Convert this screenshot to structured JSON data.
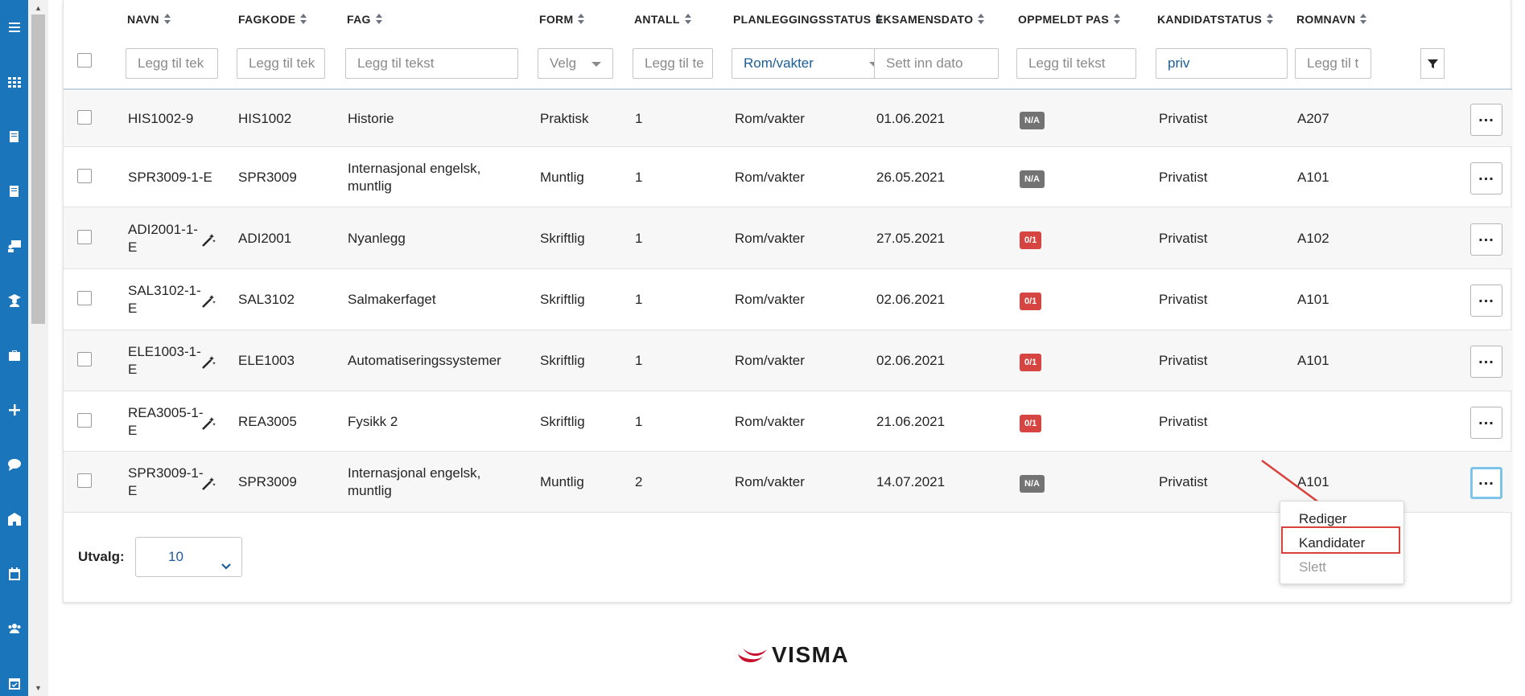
{
  "sidebar": {
    "icons": [
      "menu-icon",
      "apps-grid-icon",
      "book-icon",
      "book-open-icon",
      "presentation-icon",
      "graduate-icon",
      "briefcase-icon",
      "plus-icon",
      "chat-icon",
      "school-icon",
      "calendar-icon",
      "users-icon",
      "calendar-check-icon"
    ]
  },
  "table": {
    "columns": [
      {
        "label": "NAVN",
        "filter": "Legg til tek",
        "filled": false
      },
      {
        "label": "FAGKODE",
        "filter": "Legg til tek",
        "filled": false
      },
      {
        "label": "FAG",
        "filter": "Legg til tekst",
        "filled": false
      },
      {
        "label": "FORM",
        "filter": "Velg",
        "filled": false,
        "select": true
      },
      {
        "label": "ANTALL",
        "filter": "Legg til te",
        "filled": false
      },
      {
        "label": "PLANLEGGINGSSTATUS",
        "filter": "Rom/vakter",
        "filled": true,
        "select": true
      },
      {
        "label": "EKSAMENSDATO",
        "filter": "Sett inn dato",
        "filled": false
      },
      {
        "label": "OPPMELDT PAS",
        "filter": "Legg til tekst",
        "filled": false
      },
      {
        "label": "KANDIDATSTATUS",
        "filter": "priv",
        "filled": true
      },
      {
        "label": "ROMNAVN",
        "filter": "Legg til t",
        "filled": false
      }
    ],
    "rows": [
      {
        "navn": "HIS1002-9",
        "navn2": "",
        "wand": false,
        "fagkode": "HIS1002",
        "fag": "Historie",
        "fag2": "",
        "form": "Praktisk",
        "antall": "1",
        "planlegging": "Rom/vakter",
        "dato": "01.06.2021",
        "pas": "N/A",
        "pas_color": "gray",
        "kandidat": "Privatist",
        "rom": "A207"
      },
      {
        "navn": "SPR3009-1-E",
        "navn2": "",
        "wand": false,
        "fagkode": "SPR3009",
        "fag": "Internasjonal engelsk,",
        "fag2": "muntlig",
        "form": "Muntlig",
        "antall": "1",
        "planlegging": "Rom/vakter",
        "dato": "26.05.2021",
        "pas": "N/A",
        "pas_color": "gray",
        "kandidat": "Privatist",
        "rom": "A101"
      },
      {
        "navn": "ADI2001-1-",
        "navn2": "E",
        "wand": true,
        "fagkode": "ADI2001",
        "fag": "Nyanlegg",
        "fag2": "",
        "form": "Skriftlig",
        "antall": "1",
        "planlegging": "Rom/vakter",
        "dato": "27.05.2021",
        "pas": "0/1",
        "pas_color": "red",
        "kandidat": "Privatist",
        "rom": "A102"
      },
      {
        "navn": "SAL3102-1-",
        "navn2": "E",
        "wand": true,
        "fagkode": "SAL3102",
        "fag": "Salmakerfaget",
        "fag2": "",
        "form": "Skriftlig",
        "antall": "1",
        "planlegging": "Rom/vakter",
        "dato": "02.06.2021",
        "pas": "0/1",
        "pas_color": "red",
        "kandidat": "Privatist",
        "rom": "A101"
      },
      {
        "navn": "ELE1003-1-",
        "navn2": "E",
        "wand": true,
        "fagkode": "ELE1003",
        "fag": "Automatiseringssystemer",
        "fag2": "",
        "form": "Skriftlig",
        "antall": "1",
        "planlegging": "Rom/vakter",
        "dato": "02.06.2021",
        "pas": "0/1",
        "pas_color": "red",
        "kandidat": "Privatist",
        "rom": "A101"
      },
      {
        "navn": "REA3005-1-",
        "navn2": "E",
        "wand": true,
        "fagkode": "REA3005",
        "fag": "Fysikk 2",
        "fag2": "",
        "form": "Skriftlig",
        "antall": "1",
        "planlegging": "Rom/vakter",
        "dato": "21.06.2021",
        "pas": "0/1",
        "pas_color": "red",
        "kandidat": "Privatist",
        "rom": ""
      },
      {
        "navn": "SPR3009-1-",
        "navn2": "E",
        "wand": true,
        "fagkode": "SPR3009",
        "fag": "Internasjonal engelsk,",
        "fag2": "muntlig",
        "form": "Muntlig",
        "antall": "2",
        "planlegging": "Rom/vakter",
        "dato": "14.07.2021",
        "pas": "N/A",
        "pas_color": "gray",
        "kandidat": "Privatist",
        "rom": "A101"
      }
    ]
  },
  "footer": {
    "utvalg_label": "Utvalg:",
    "page_size": "10"
  },
  "menu": {
    "items": [
      {
        "label": "Rediger",
        "disabled": false
      },
      {
        "label": "Kandidater",
        "disabled": false,
        "highlighted": true
      },
      {
        "label": "Slett",
        "disabled": true
      }
    ]
  },
  "logo": {
    "text": "VISMA"
  },
  "colors": {
    "accent": "#1b75bb",
    "badge_gray": "#737373",
    "badge_red": "#d64541",
    "highlight": "#d9413c"
  }
}
